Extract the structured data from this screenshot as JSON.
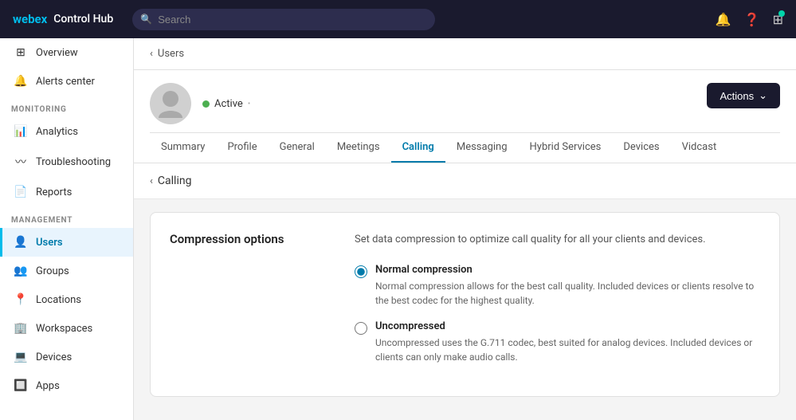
{
  "app": {
    "brand": "webex",
    "title": "Control Hub"
  },
  "topnav": {
    "search_placeholder": "Search",
    "icons": [
      "bell",
      "question",
      "grid"
    ]
  },
  "sidebar": {
    "sections": [
      {
        "label": "",
        "items": [
          {
            "id": "overview",
            "label": "Overview",
            "icon": "⊞"
          },
          {
            "id": "alerts",
            "label": "Alerts center",
            "icon": "🔔"
          }
        ]
      },
      {
        "label": "Monitoring",
        "items": [
          {
            "id": "analytics",
            "label": "Analytics",
            "icon": "📊"
          },
          {
            "id": "troubleshooting",
            "label": "Troubleshooting",
            "icon": "〰"
          },
          {
            "id": "reports",
            "label": "Reports",
            "icon": "📄"
          }
        ]
      },
      {
        "label": "Management",
        "items": [
          {
            "id": "users",
            "label": "Users",
            "icon": "👤",
            "active": true
          },
          {
            "id": "groups",
            "label": "Groups",
            "icon": "👥"
          },
          {
            "id": "locations",
            "label": "Locations",
            "icon": "📍"
          },
          {
            "id": "workspaces",
            "label": "Workspaces",
            "icon": "🏢"
          },
          {
            "id": "devices",
            "label": "Devices",
            "icon": "💻"
          },
          {
            "id": "apps",
            "label": "Apps",
            "icon": "🔲"
          }
        ]
      }
    ]
  },
  "breadcrumb": {
    "back_label": "Users"
  },
  "user": {
    "status": "Active",
    "status_color": "#4caf50"
  },
  "actions_button": "Actions",
  "tabs": [
    {
      "id": "summary",
      "label": "Summary"
    },
    {
      "id": "profile",
      "label": "Profile"
    },
    {
      "id": "general",
      "label": "General"
    },
    {
      "id": "meetings",
      "label": "Meetings"
    },
    {
      "id": "calling",
      "label": "Calling",
      "active": true
    },
    {
      "id": "messaging",
      "label": "Messaging"
    },
    {
      "id": "hybrid-services",
      "label": "Hybrid Services"
    },
    {
      "id": "devices",
      "label": "Devices"
    },
    {
      "id": "vidcast",
      "label": "Vidcast"
    }
  ],
  "sub_breadcrumb": "Calling",
  "compression": {
    "section_label": "Compression options",
    "description": "Set data compression to optimize call quality for all your clients and devices.",
    "options": [
      {
        "id": "normal",
        "label": "Normal compression",
        "sublabel": "Normal compression allows for the best call quality. Included devices or clients resolve to the best codec for the highest quality.",
        "selected": true
      },
      {
        "id": "uncompressed",
        "label": "Uncompressed",
        "sublabel": "Uncompressed uses the G.711 codec, best suited for analog devices. Included devices or clients can only make audio calls.",
        "selected": false
      }
    ]
  }
}
